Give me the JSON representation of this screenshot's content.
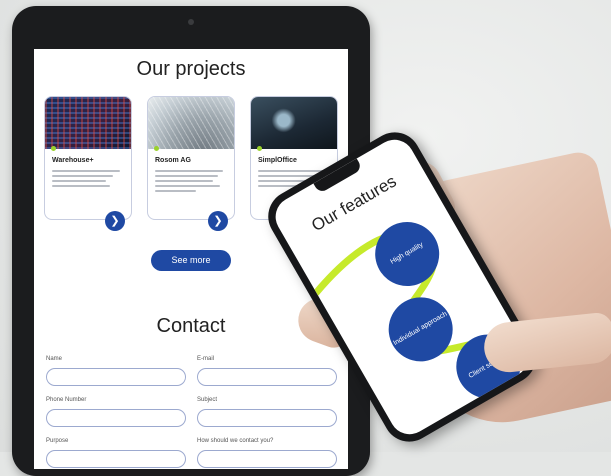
{
  "tablet": {
    "projects_title": "Our projects",
    "projects": [
      {
        "name": "Warehouse+"
      },
      {
        "name": "Rosom AG"
      },
      {
        "name": "SimplOffice"
      }
    ],
    "see_more": "See more",
    "contact_title": "Contact",
    "form": {
      "name_label": "Name",
      "email_label": "E-mail",
      "phone_label": "Phone Number",
      "subject_label": "Subject",
      "purpose_label": "Purpose",
      "contact_method_label": "How should we contact you?"
    }
  },
  "phone": {
    "features_title": "Our features",
    "features": [
      "High quality",
      "Individual approach",
      "Client support"
    ]
  },
  "colors": {
    "brand_blue": "#1f49a3",
    "accent_lime": "#c6ea2b",
    "device_black": "#1b1c1e"
  }
}
